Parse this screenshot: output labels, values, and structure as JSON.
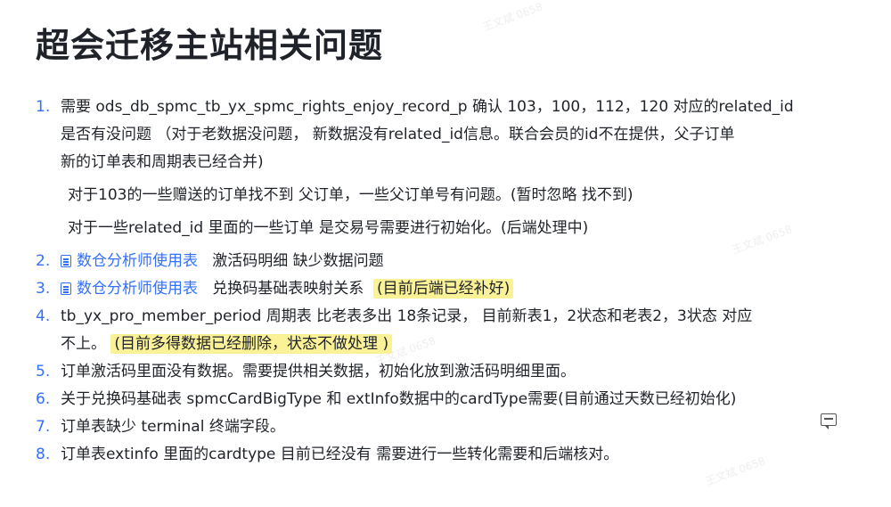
{
  "title": "超会迁移主站相关问题",
  "watermark": "王文斌 0658",
  "colors": {
    "link": "#3370ff",
    "highlight": "#fbf197",
    "text": "#1f2329"
  },
  "items": [
    {
      "num": "1.",
      "lines": [
        "需要 ods_db_spmc_tb_yx_spmc_rights_enjoy_record_p 确认 103，100，112，120 对应的related_id",
        "是否有没问题 （对于老数据没问题， 新数据没有related_id信息。联合会员的id不在提供，父子订单",
        "新的订单表和周期表已经合并)"
      ],
      "subs": [
        "对于103的一些赠送的订单找不到 父订单，一些父订单号有问题。(暂时忽略 找不到)",
        "对于一些related_id 里面的一些订单 是交易号需要进行初始化。(后端处理中)"
      ]
    },
    {
      "num": "2.",
      "link": "数仓分析师使用表",
      "link_icon": "doc-icon",
      "text": "激活码明细  缺少数据问题"
    },
    {
      "num": "3.",
      "link": "数仓分析师使用表",
      "link_icon": "doc-icon",
      "text": "兑换码基础表映射关系",
      "highlight": "(目前后端已经补好)"
    },
    {
      "num": "4.",
      "lines": [
        "tb_yx_pro_member_period 周期表 比老表多出 18条记录，  目前新表1，2状态和老表2，3状态 对应"
      ],
      "line2_text": "不上。",
      "highlight": "(目前多得数据已经删除，状态不做处理 )"
    },
    {
      "num": "5.",
      "text": "订单激活码里面没有数据。需要提供相关数据，初始化放到激活码明细里面。"
    },
    {
      "num": "6.",
      "text": "关于兑换码基础表 spmcCardBigType 和 extInfo数据中的cardType需要(目前通过天数已经初始化)",
      "action_icon": "comment-icon"
    },
    {
      "num": "7.",
      "text": "订单表缺少 terminal 终端字段。"
    },
    {
      "num": "8.",
      "text": "订单表extinfo 里面的cardtype 目前已经没有 需要进行一些转化需要和后端核对。"
    }
  ]
}
